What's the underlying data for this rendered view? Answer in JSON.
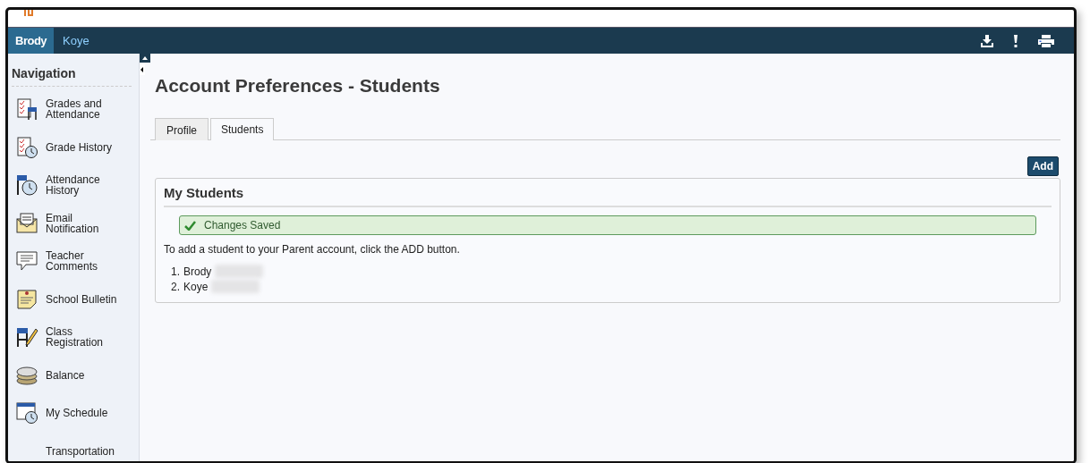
{
  "topbar": {
    "students": [
      {
        "label": "Brody",
        "selected": true
      },
      {
        "label": "Koye",
        "selected": false
      }
    ]
  },
  "sidebar": {
    "title": "Navigation",
    "items": [
      {
        "label": "Grades and Attendance"
      },
      {
        "label": "Grade History"
      },
      {
        "label": "Attendance History"
      },
      {
        "label": "Email Notification"
      },
      {
        "label": "Teacher Comments"
      },
      {
        "label": "School Bulletin"
      },
      {
        "label": "Class Registration"
      },
      {
        "label": "Balance"
      },
      {
        "label": "My Schedule"
      },
      {
        "label": "Transportation"
      }
    ]
  },
  "page": {
    "title": "Account Preferences - Students",
    "tabs": [
      {
        "label": "Profile",
        "selected": false
      },
      {
        "label": "Students",
        "selected": true
      }
    ],
    "add_button": "Add",
    "panel": {
      "title": "My Students",
      "message": "Changes Saved",
      "instructions": "To add a student to your Parent account, click the ADD button.",
      "students": [
        {
          "number": "1.",
          "name": "Brody"
        },
        {
          "number": "2.",
          "name": "Koye"
        }
      ]
    }
  }
}
